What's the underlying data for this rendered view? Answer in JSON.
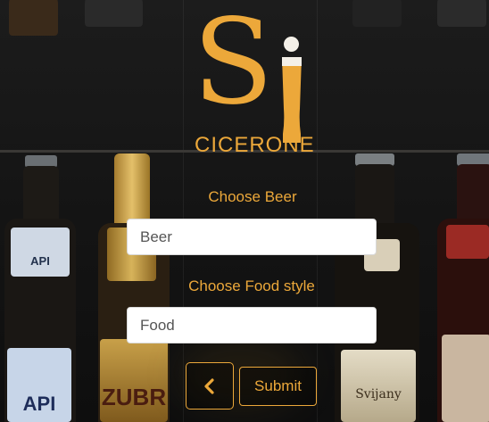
{
  "brand": {
    "logo_letter": "S",
    "name": "CICERONE"
  },
  "form": {
    "beer": {
      "label": "Choose Beer",
      "placeholder": "Beer",
      "value": ""
    },
    "food": {
      "label": "Choose Food style",
      "placeholder": "Food",
      "value": ""
    },
    "back_icon": "chevron-left-icon",
    "submit_label": "Submit"
  },
  "background": {
    "bottle_labels": [
      "API",
      "ZUBR",
      "Svijany",
      "API"
    ]
  },
  "colors": {
    "accent": "#eca83a",
    "input_bg": "#ffffff"
  }
}
